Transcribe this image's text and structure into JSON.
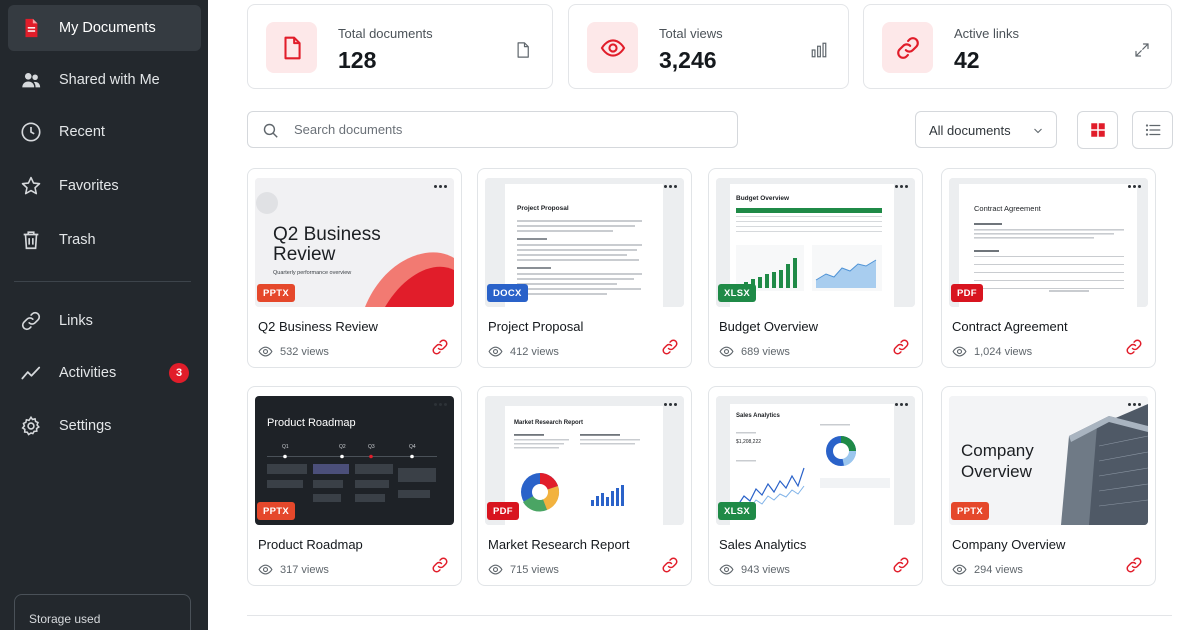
{
  "colors": {
    "accent": "#e11d2a",
    "sidebar_bg": "#23282d",
    "pptx": "#e5482b",
    "docx": "#2a62c9",
    "xlsx": "#1f8a47",
    "pdf": "#d8141f"
  },
  "sidebar": {
    "items": [
      {
        "label": "My Documents",
        "icon": "document-icon"
      },
      {
        "label": "Shared with Me",
        "icon": "users-icon"
      },
      {
        "label": "Recent",
        "icon": "clock-icon"
      },
      {
        "label": "Favorites",
        "icon": "star-icon"
      },
      {
        "label": "Trash",
        "icon": "trash-icon"
      },
      {
        "label": "Links",
        "icon": "link-icon"
      },
      {
        "label": "Activities",
        "icon": "activity-icon",
        "badge": "3"
      },
      {
        "label": "Settings",
        "icon": "gear-icon"
      }
    ],
    "storage_label": "Storage used"
  },
  "stats": [
    {
      "label": "Total documents",
      "value": "128",
      "icon": "file-icon",
      "side_icon": "file-outline-icon"
    },
    {
      "label": "Total views",
      "value": "3,246",
      "icon": "eye-icon",
      "side_icon": "bar-chart-icon"
    },
    {
      "label": "Active links",
      "value": "42",
      "icon": "link-icon",
      "side_icon": "expand-icon"
    }
  ],
  "toolbar": {
    "search_placeholder": "Search documents",
    "filter_value": "All documents"
  },
  "documents": [
    {
      "title": "Q2 Business Review",
      "views": "532 views",
      "type": "PPTX",
      "thumb": {
        "heading": "Q2 Business",
        "heading2": "Review",
        "sub": "Quarterly performance overview"
      }
    },
    {
      "title": "Project Proposal",
      "views": "412 views",
      "type": "DOCX",
      "thumb": {
        "heading": "Project Proposal"
      }
    },
    {
      "title": "Budget Overview",
      "views": "689 views",
      "type": "XLSX",
      "thumb": {
        "heading": "Budget Overview"
      }
    },
    {
      "title": "Contract Agreement",
      "views": "1,024 views",
      "type": "PDF",
      "thumb": {
        "heading": "Contract Agreement"
      }
    },
    {
      "title": "Product Roadmap",
      "views": "317 views",
      "type": "PPTX",
      "thumb": {
        "heading": "Product Roadmap",
        "quarters": [
          "Q1",
          "Q2",
          "Q3",
          "Q4"
        ]
      }
    },
    {
      "title": "Market Research Report",
      "views": "715 views",
      "type": "PDF",
      "thumb": {
        "heading": "Market Research Report"
      }
    },
    {
      "title": "Sales Analytics",
      "views": "943 views",
      "type": "XLSX",
      "thumb": {
        "heading": "Sales Analytics",
        "kpi": "$1,208,222"
      }
    },
    {
      "title": "Company Overview",
      "views": "294 views",
      "type": "PPTX",
      "thumb": {
        "heading": "Company",
        "heading2": "Overview"
      }
    }
  ]
}
